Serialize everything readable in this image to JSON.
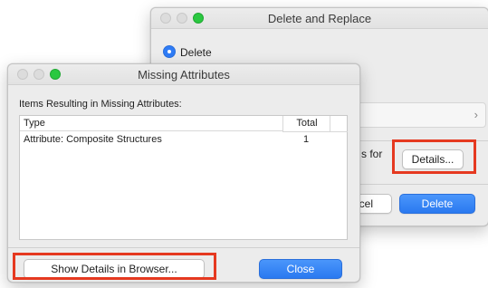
{
  "back_window": {
    "title": "Delete and Replace",
    "delete_radio_label": "Delete",
    "info_partial": "s for",
    "details_button": "Details...",
    "cancel_button": "ncel",
    "delete_button": "Delete",
    "chevron": "›"
  },
  "front_window": {
    "title": "Missing Attributes",
    "section_label": "Items Resulting in Missing Attributes:",
    "table": {
      "columns": [
        "Type",
        "Total"
      ],
      "rows": [
        {
          "type": "Attribute: Composite Structures",
          "total": "1"
        }
      ]
    },
    "show_details_button": "Show Details in Browser...",
    "close_button": "Close"
  },
  "highlight_color": "#e53920",
  "accent_color": "#2f7cf6"
}
